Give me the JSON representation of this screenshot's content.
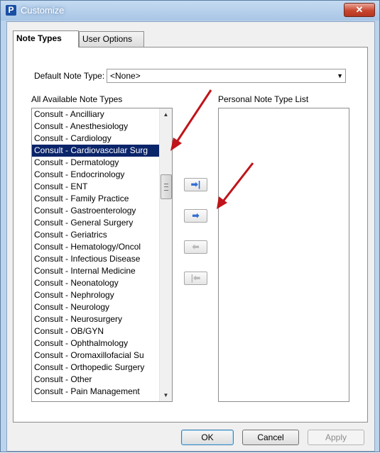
{
  "window": {
    "app_icon": "P",
    "title": "Customize",
    "close_glyph": "✕"
  },
  "tabs": [
    {
      "label": "Note Types"
    },
    {
      "label": "User Options"
    }
  ],
  "default_note_type": {
    "label": "Default Note Type:",
    "value": "<None>"
  },
  "available": {
    "label": "All Available Note Types",
    "items": [
      "Consult - Ancilliary",
      "Consult - Anesthesiology",
      "Consult - Cardiology",
      "Consult - Cardiovascular Surg",
      "Consult - Dermatology",
      "Consult - Endocrinology",
      "Consult - ENT",
      "Consult - Family Practice",
      "Consult - Gastroenterology",
      "Consult - General Surgery",
      "Consult - Geriatrics",
      "Consult - Hematology/Oncol",
      "Consult - Infectious Disease",
      "Consult - Internal Medicine",
      "Consult - Neonatology",
      "Consult - Nephrology",
      "Consult - Neurology",
      "Consult - Neurosurgery",
      "Consult - OB/GYN",
      "Consult - Ophthalmology",
      "Consult - Oromaxillofacial Su",
      "Consult - Orthopedic Surgery",
      "Consult - Other",
      "Consult - Pain Management"
    ],
    "selected_index": 3
  },
  "personal": {
    "label": "Personal Note Type List",
    "items": []
  },
  "move_buttons": [
    {
      "icon": "add-all-arrow-icon",
      "glyph": "➡|",
      "enabled": true
    },
    {
      "icon": "add-arrow-icon",
      "glyph": "➡",
      "enabled": true
    },
    {
      "icon": "remove-arrow-icon",
      "glyph": "⬅",
      "enabled": false
    },
    {
      "icon": "remove-all-arrow-icon",
      "glyph": "|⬅",
      "enabled": false
    }
  ],
  "buttons": {
    "ok": "OK",
    "cancel": "Cancel",
    "apply": "Apply"
  },
  "colors": {
    "selection": "#0a246a",
    "annotation_arrow": "#c0141a",
    "move_arrow": "#2f6ed0"
  }
}
